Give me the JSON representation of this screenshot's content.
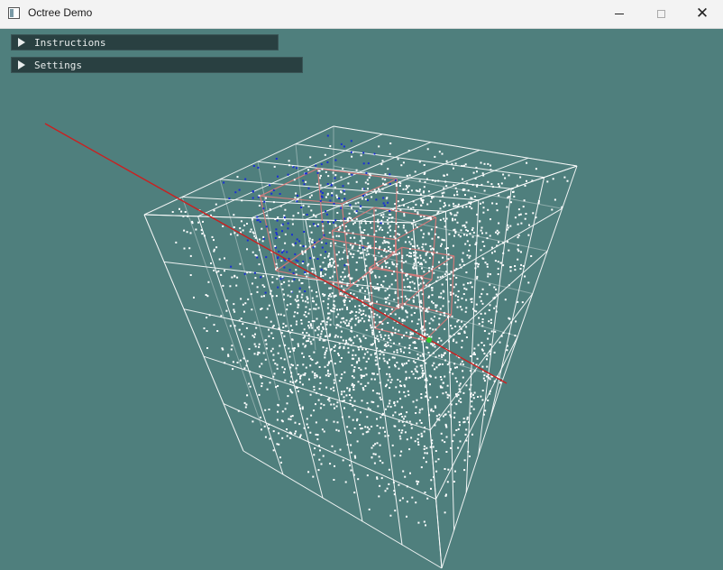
{
  "window": {
    "title": "Octree Demo",
    "icon": "app-window-icon",
    "controls": {
      "minimize": "minimize-icon",
      "maximize": "maximize-icon",
      "close": "✕"
    }
  },
  "panels": [
    {
      "label": "Instructions",
      "icon": "triangle-right-icon",
      "collapsed": true
    },
    {
      "label": "Settings",
      "icon": "triangle-right-icon",
      "collapsed": true
    }
  ],
  "scene": {
    "background": "#4f7f7d",
    "grid_color": "#ffffff",
    "ray_color": "#cc1f1f",
    "highlight_box_color": "#d77a7a",
    "point_color": "#ffffff",
    "selected_point_color": "#1a2fd6",
    "hit_point_color": "#30d030",
    "subdivisions": 5
  }
}
